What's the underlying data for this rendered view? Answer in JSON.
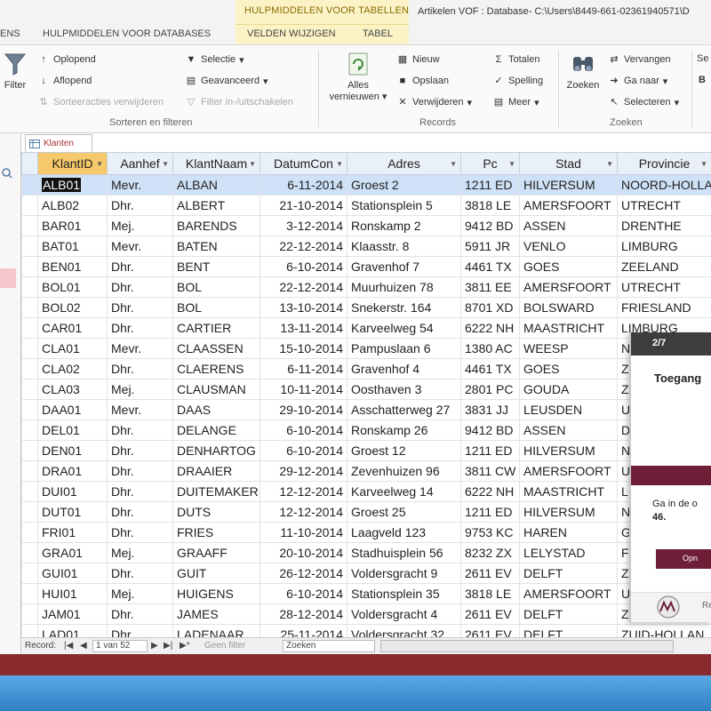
{
  "window": {
    "context_group": "HULPMIDDELEN VOOR TABELLEN",
    "title": "Artikelen VOF : Database- C:\\Users\\8449-661-02361940571\\D"
  },
  "ribbon_tabs": [
    "ENS",
    "HULPMIDDELEN VOOR DATABASES",
    "VELDEN WIJZIGEN",
    "TABEL"
  ],
  "ribbon": {
    "filter": {
      "filter_label": "Filter",
      "oplopend": "Oplopend",
      "aflopend": "Aflopend",
      "sorteeracties": "Sorteeracties verwijderen",
      "selectie": "Selectie",
      "geavanceerd": "Geavanceerd",
      "filter_in_uit": "Filter in-/uitschakelen",
      "group_label": "Sorteren en filteren"
    },
    "records": {
      "alles_vernieuwen_1": "Alles",
      "alles_vernieuwen_2": "vernieuwen",
      "nieuw": "Nieuw",
      "opslaan": "Opslaan",
      "verwijderen": "Verwijderen",
      "totalen": "Totalen",
      "spelling": "Spelling",
      "meer": "Meer",
      "group_label": "Records"
    },
    "zoeken": {
      "zoeken_label": "Zoeken",
      "vervangen": "Vervangen",
      "ga_naar": "Ga naar",
      "selecteren": "Selecteren",
      "group_label": "Zoeken"
    },
    "partial_right_1": "Se",
    "partial_right_2": "B"
  },
  "document_tab": {
    "label": "Klanten"
  },
  "table": {
    "columns": [
      "KlantID",
      "Aanhef",
      "KlantNaam",
      "DatumCon",
      "Adres",
      "Pc",
      "Stad",
      "Provincie"
    ],
    "rows": [
      [
        "ALB01",
        "Mevr.",
        "ALBAN",
        "6-11-2014",
        "Groest 2",
        "1211 ED",
        "HILVERSUM",
        "NOORD-HOLLA"
      ],
      [
        "ALB02",
        "Dhr.",
        "ALBERT",
        "21-10-2014",
        "Stationsplein 5",
        "3818 LE",
        "AMERSFOORT",
        "UTRECHT"
      ],
      [
        "BAR01",
        "Mej.",
        "BARENDS",
        "3-12-2014",
        "Ronskamp 2",
        "9412 BD",
        "ASSEN",
        "DRENTHE"
      ],
      [
        "BAT01",
        "Mevr.",
        "BATEN",
        "22-12-2014",
        "Klaasstr. 8",
        "5911 JR",
        "VENLO",
        "LIMBURG"
      ],
      [
        "BEN01",
        "Dhr.",
        "BENT",
        "6-10-2014",
        "Gravenhof 7",
        "4461 TX",
        "GOES",
        "ZEELAND"
      ],
      [
        "BOL01",
        "Dhr.",
        "BOL",
        "22-12-2014",
        "Muurhuizen 78",
        "3811 EE",
        "AMERSFOORT",
        "UTRECHT"
      ],
      [
        "BOL02",
        "Dhr.",
        "BOL",
        "13-10-2014",
        "Snekerstr. 164",
        "8701 XD",
        "BOLSWARD",
        "FRIESLAND"
      ],
      [
        "CAR01",
        "Dhr.",
        "CARTIER",
        "13-11-2014",
        "Karveelweg 54",
        "6222 NH",
        "MAASTRICHT",
        "LIMBURG"
      ],
      [
        "CLA01",
        "Mevr.",
        "CLAASSEN",
        "15-10-2014",
        "Pampuslaan 6",
        "1380 AC",
        "WEESP",
        "N"
      ],
      [
        "CLA02",
        "Dhr.",
        "CLAERENS",
        "6-11-2014",
        "Gravenhof 4",
        "4461 TX",
        "GOES",
        "Z"
      ],
      [
        "CLA03",
        "Mej.",
        "CLAUSMAN",
        "10-11-2014",
        "Oosthaven 3",
        "2801 PC",
        "GOUDA",
        "Z"
      ],
      [
        "DAA01",
        "Mevr.",
        "DAAS",
        "29-10-2014",
        "Asschatterweg 27",
        "3831 JJ",
        "LEUSDEN",
        "U"
      ],
      [
        "DEL01",
        "Dhr.",
        "DELANGE",
        "6-10-2014",
        "Ronskamp 26",
        "9412 BD",
        "ASSEN",
        "D"
      ],
      [
        "DEN01",
        "Dhr.",
        "DENHARTOG",
        "6-10-2014",
        "Groest 12",
        "1211 ED",
        "HILVERSUM",
        "N"
      ],
      [
        "DRA01",
        "Dhr.",
        "DRAAIER",
        "29-12-2014",
        "Zevenhuizen 96",
        "3811 CW",
        "AMERSFOORT",
        "U"
      ],
      [
        "DUI01",
        "Dhr.",
        "DUITEMAKER",
        "12-12-2014",
        "Karveelweg 14",
        "6222 NH",
        "MAASTRICHT",
        "L"
      ],
      [
        "DUT01",
        "Dhr.",
        "DUTS",
        "12-12-2014",
        "Groest 25",
        "1211 ED",
        "HILVERSUM",
        "N"
      ],
      [
        "FRI01",
        "Dhr.",
        "FRIES",
        "11-10-2014",
        "Laagveld 123",
        "9753 KC",
        "HAREN",
        "G"
      ],
      [
        "GRA01",
        "Mej.",
        "GRAAFF",
        "20-10-2014",
        "Stadhuisplein 56",
        "8232 ZX",
        "LELYSTAD",
        "F"
      ],
      [
        "GUI01",
        "Dhr.",
        "GUIT",
        "26-12-2014",
        "Voldersgracht 9",
        "2611 EV",
        "DELFT",
        "Z"
      ],
      [
        "HUI01",
        "Mej.",
        "HUIGENS",
        "6-10-2014",
        "Stationsplein 35",
        "3818 LE",
        "AMERSFOORT",
        "U"
      ],
      [
        "JAM01",
        "Dhr.",
        "JAMES",
        "28-12-2014",
        "Voldersgracht 4",
        "2611 EV",
        "DELFT",
        "Z"
      ],
      [
        "LAD01",
        "Dhr.",
        "LADENAAR",
        "25-11-2014",
        "Voldersgracht 32",
        "2611 EV",
        "DELFT",
        "ZUID-HOLLAN"
      ]
    ]
  },
  "record_nav": {
    "label": "Record:",
    "current": "1 van 52",
    "filter_state": "Geen filter",
    "search_placeholder": "Zoeken"
  },
  "tutorial": {
    "step": "2/7",
    "title": "Toegang",
    "text_line1": "Ga in de o",
    "text_line2": "46.",
    "button": "Opn",
    "footer": "Ref"
  },
  "colors": {
    "accent_band": "#8b2a2e",
    "popup_accent": "#6e1f37",
    "context_tab": "#fbf2c6",
    "selected_row": "#cfe1f7"
  }
}
